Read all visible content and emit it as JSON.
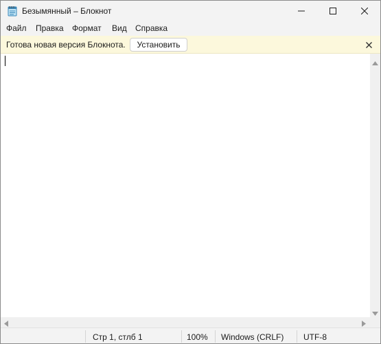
{
  "window": {
    "title": "Безымянный – Блокнот",
    "icon": "notepad-icon"
  },
  "menu": {
    "items": [
      "Файл",
      "Правка",
      "Формат",
      "Вид",
      "Справка"
    ]
  },
  "infobar": {
    "message": "Готова новая версия Блокнота.",
    "install_label": "Установить"
  },
  "editor": {
    "content": ""
  },
  "status": {
    "position": "Стр 1, стлб 1",
    "zoom": "100%",
    "line_endings": "Windows (CRLF)",
    "encoding": "UTF-8"
  },
  "colors": {
    "infobar_bg": "#fcf8dc",
    "chrome_bg": "#f3f3f3"
  }
}
